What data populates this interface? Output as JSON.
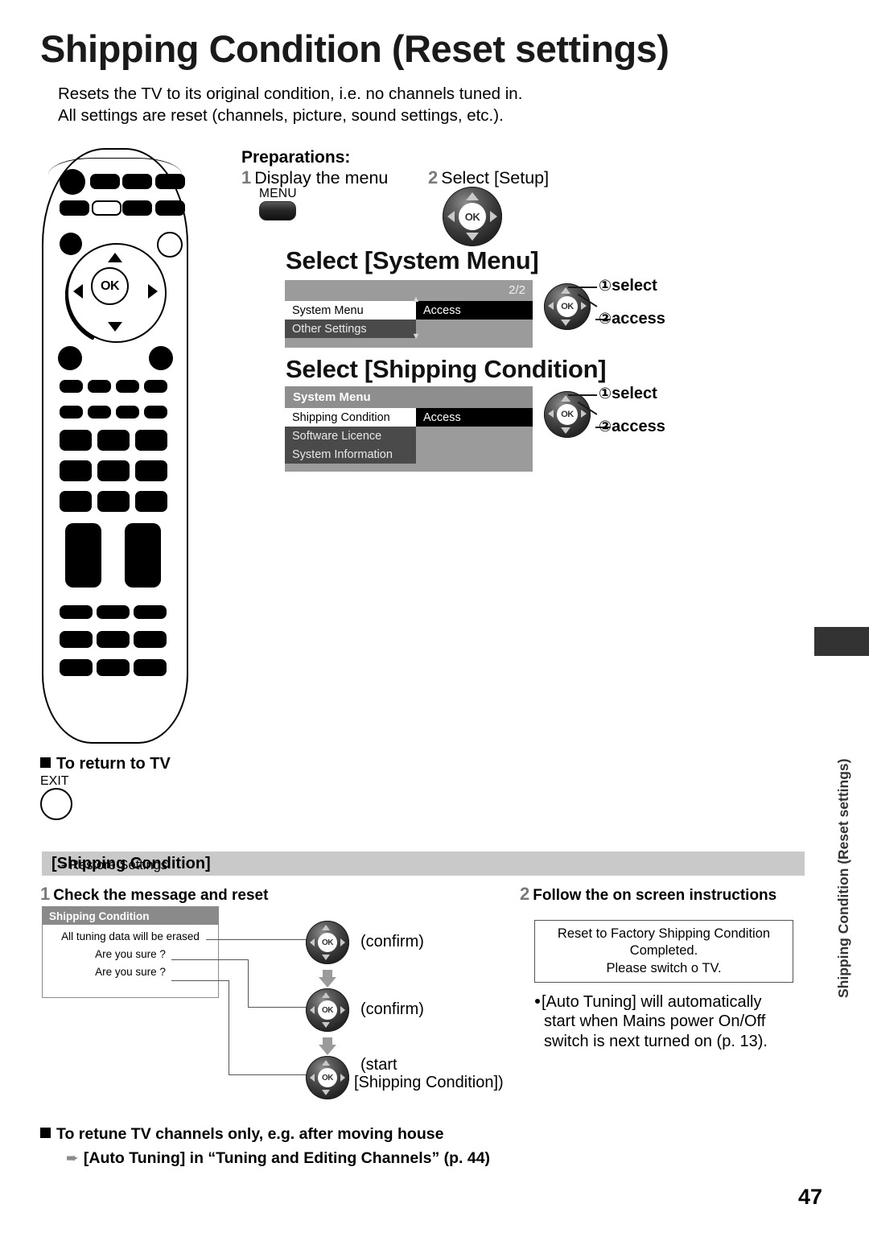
{
  "page": {
    "title": "Shipping Condition (Reset settings)",
    "subtitle_line1": "Resets the TV to its original condition, i.e. no channels tuned in.",
    "subtitle_line2": "All settings are reset (channels, picture, sound settings, etc.).",
    "number": "47",
    "side_tab_label": "Shipping Condition (Reset settings)"
  },
  "preparations": {
    "heading": "Preparations:",
    "step1_num": "1",
    "step1_text": "Display the menu",
    "menu_button_label": "MENU",
    "step2_num": "2",
    "step2_text": "Select [Setup]",
    "ok_label": "OK"
  },
  "section_system_menu": {
    "heading": "Select [System Menu]",
    "page_indicator": "2/2",
    "rows": [
      {
        "label": "System Menu",
        "value": "Access"
      },
      {
        "label": "Other Settings",
        "value": ""
      }
    ],
    "hint1_num": "①",
    "hint1": "select",
    "hint2_num": "②",
    "hint2": "access",
    "ok_label": "OK"
  },
  "section_shipping_condition": {
    "heading": "Select [Shipping Condition]",
    "menu_title": "System Menu",
    "rows": [
      {
        "label": "Shipping Condition",
        "value": "Access"
      },
      {
        "label": "Software Licence",
        "value": ""
      },
      {
        "label": "System Information",
        "value": ""
      }
    ],
    "hint1_num": "①",
    "hint1": "select",
    "hint2_num": "②",
    "hint2": "access",
    "ok_label": "OK"
  },
  "return_to_tv": {
    "heading": "To return to TV",
    "button_label": "EXIT"
  },
  "restore": {
    "bar_bold": "[Shipping Condition]",
    "bar_normal": " - Restore Settings",
    "step1_num": "1",
    "step1_label": "Check the message and reset",
    "step2_num": "2",
    "step2_label": "Follow the on screen instructions",
    "dialog": {
      "title": "Shipping Condition",
      "line1": "All tuning data will be erased",
      "line2": "Are you sure ?",
      "line3": "Are you sure ?"
    },
    "actions": [
      {
        "caption": "(confirm)",
        "caption2": "",
        "ok_label": "OK"
      },
      {
        "caption": "(confirm)",
        "caption2": "",
        "ok_label": "OK"
      },
      {
        "caption": "(start",
        "caption2": "[Shipping Condition])",
        "ok_label": "OK"
      }
    ],
    "message_box": {
      "line1": "Reset to Factory Shipping Condition",
      "line2": "Completed.",
      "line3": "Please switch o  TV."
    },
    "note": "[Auto Tuning] will automatically start when Mains power On/Off switch is next turned on (p. 13)."
  },
  "footer": {
    "line1": "To retune TV channels only, e.g. after moving house",
    "line2": "[Auto Tuning] in “Tuning and Editing Channels” (p. 44)"
  }
}
